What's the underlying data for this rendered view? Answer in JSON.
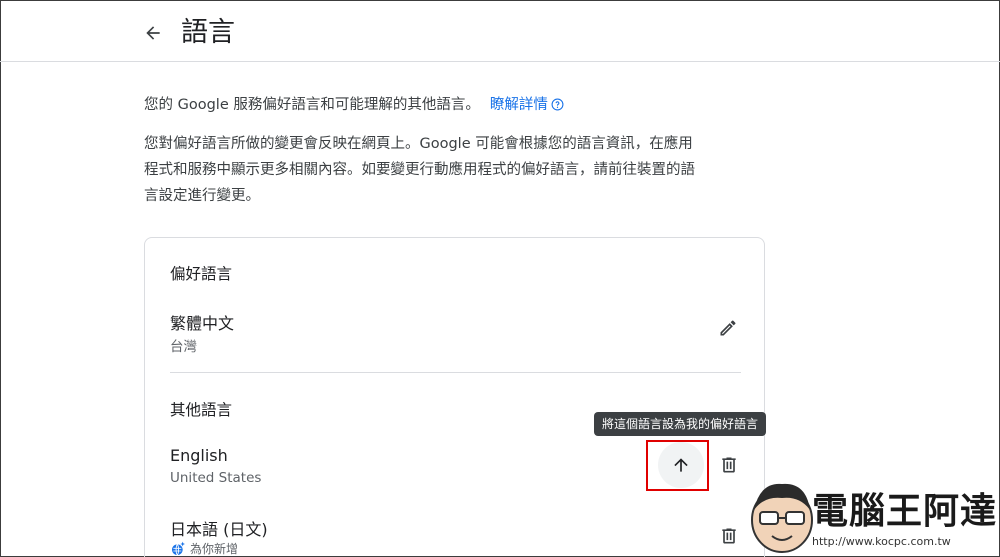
{
  "header": {
    "back_icon": "arrow-back-icon",
    "title": "語言"
  },
  "intro": {
    "text": "您的 Google 服務偏好語言和可能理解的其他語言。",
    "link": "瞭解詳情"
  },
  "description": "您對偏好語言所做的變更會反映在網頁上。Google 可能會根據您的語言資訊，在應用程式和服務中顯示更多相關內容。如要變更行動應用程式的偏好語言，請前往裝置的語言設定進行變更。",
  "preferred": {
    "title": "偏好語言",
    "language": "繁體中文",
    "region": "台灣"
  },
  "others": {
    "title": "其他語言",
    "items": [
      {
        "language": "English",
        "region": "United States"
      },
      {
        "language": "日本語 (日文)",
        "region": "為你新增"
      }
    ]
  },
  "tooltip": "將這個語言設為我的偏好語言",
  "watermark": {
    "title": "電腦王阿達",
    "url": "http://www.kocpc.com.tw"
  },
  "colors": {
    "link": "#1a73e8",
    "highlight": "#e00000",
    "tooltip_bg": "#3c4043"
  }
}
